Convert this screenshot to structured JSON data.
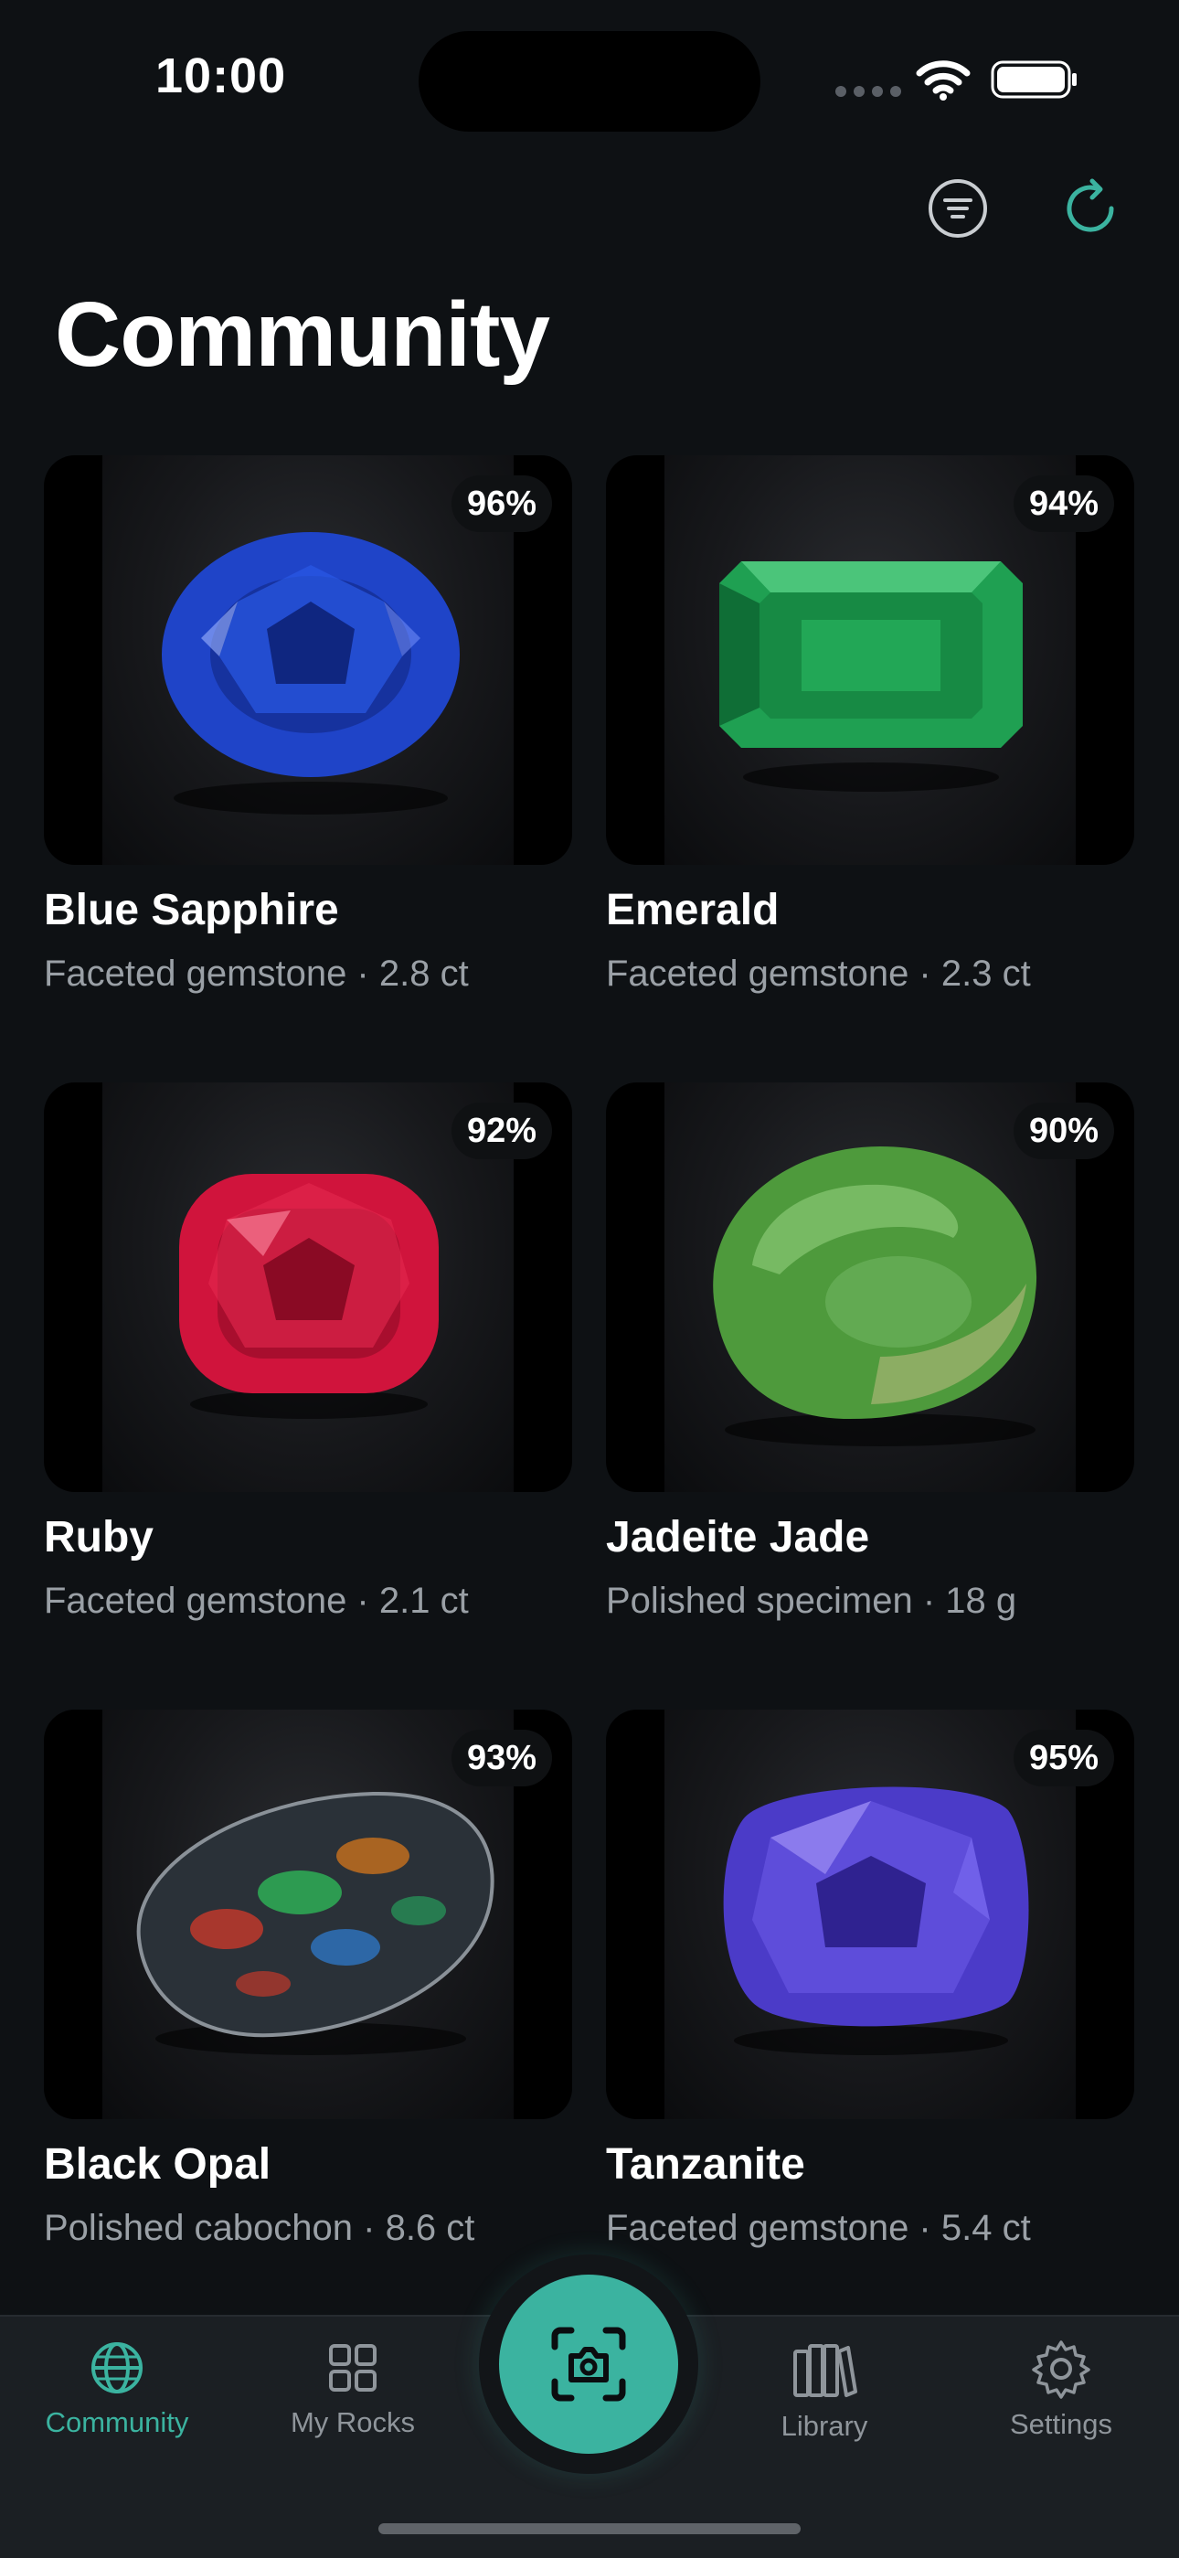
{
  "status": {
    "time": "10:00"
  },
  "page": {
    "title": "Community"
  },
  "cards": [
    {
      "name": "Blue Sapphire",
      "meta": "Faceted gemstone · 2.8 ct",
      "confidence": "96%",
      "color": "#1f44c8"
    },
    {
      "name": "Emerald",
      "meta": "Faceted gemstone · 2.3 ct",
      "confidence": "94%",
      "color": "#1fa052"
    },
    {
      "name": "Ruby",
      "meta": "Faceted gemstone · 2.1 ct",
      "confidence": "92%",
      "color": "#d0143c"
    },
    {
      "name": "Jadeite Jade",
      "meta": "Polished specimen · 18 g",
      "confidence": "90%",
      "color": "#4e9a3c"
    },
    {
      "name": "Black Opal",
      "meta": "Polished cabochon · 8.6 ct",
      "confidence": "93%",
      "color": "#2a3138"
    },
    {
      "name": "Tanzanite",
      "meta": "Faceted gemstone · 5.4 ct",
      "confidence": "95%",
      "color": "#4b3bc8"
    }
  ],
  "tabs": [
    {
      "label": "Community",
      "icon": "globe-icon",
      "active": true
    },
    {
      "label": "My Rocks",
      "icon": "grid-icon",
      "active": false
    },
    {
      "label": "Library",
      "icon": "books-icon",
      "active": false
    },
    {
      "label": "Settings",
      "icon": "gear-icon",
      "active": false
    }
  ],
  "colors": {
    "accent": "#3bb3a0",
    "background": "#0e1114",
    "muted": "#9aa0a6"
  }
}
